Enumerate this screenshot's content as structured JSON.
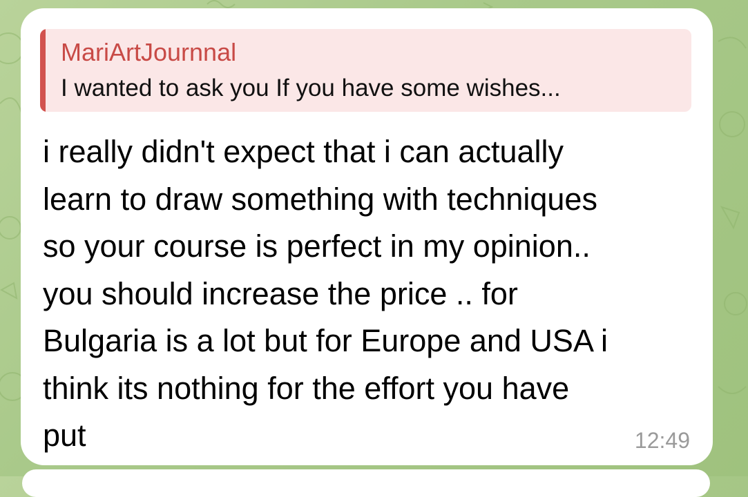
{
  "chat": {
    "reply": {
      "author": "MariArtJournnal",
      "preview": "I wanted to ask you If you have some wishes..."
    },
    "message": {
      "lines": [
        "i really didn't expect that i can actually",
        "learn to draw something with techniques",
        "so your course is perfect in my opinion..",
        "you should increase the price .. for",
        "Bulgaria is a lot but for Europe and USA i",
        "think its nothing for the effort you have",
        "put"
      ],
      "time": "12:49"
    }
  },
  "colors": {
    "wallpaper": "#a9c98a",
    "bubble": "#ffffff",
    "reply_accent": "#d2524e",
    "reply_background": "#fbe7e7",
    "timestamp": "#9a9a9a"
  }
}
